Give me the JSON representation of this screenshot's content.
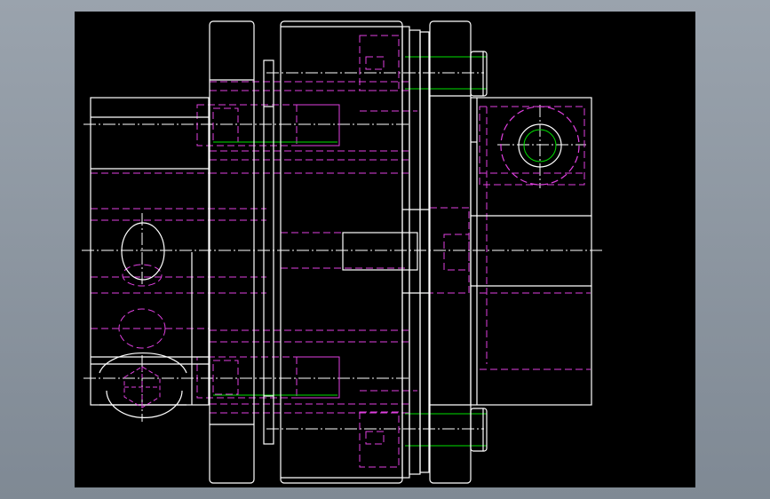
{
  "viewer": {
    "background_color": "#000000",
    "frame_color": "#8e97a1"
  },
  "drawing": {
    "subject": "coupling-assembly-section-view",
    "colors": {
      "outline": "#ffffff",
      "hidden": "#e040e0",
      "centerline": "#ffffff",
      "thread": "#00e000"
    }
  }
}
